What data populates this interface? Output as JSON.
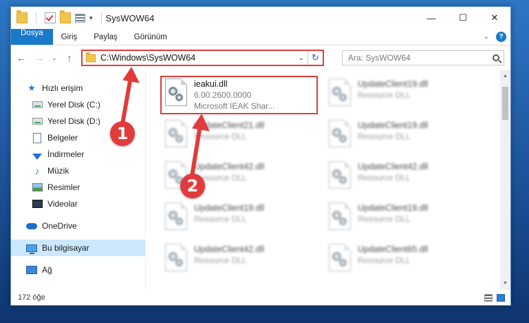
{
  "window": {
    "title": "SysWOW64",
    "controls": {
      "minimize": "—",
      "maximize": "☐",
      "close": "✕"
    }
  },
  "ribbon": {
    "tabs": [
      "Dosya",
      "Giriş",
      "Paylaş",
      "Görünüm"
    ],
    "help": "?"
  },
  "nav": {
    "address": "C:\\Windows\\SysWOW64",
    "search_placeholder": "Ara: SysWOW64"
  },
  "sidebar": {
    "quick_access": "Hızlı erişim",
    "pinned": [
      "Yerel Disk (C:)",
      "Yerel Disk (D:)",
      "Belgeler",
      "İndirmeler",
      "Müzik",
      "Resimler",
      "Videolar"
    ],
    "onedrive": "OneDrive",
    "this_pc": "Bu bilgisayar",
    "network": "Ağ"
  },
  "files": {
    "highlighted": {
      "name": "ieakui.dll",
      "version": "6.00.2600.0000",
      "description": "Microsoft IEAK Shar..."
    },
    "others": [
      {
        "name": "UpdateClient19.dll",
        "type": "Resource DLL"
      },
      {
        "name": "UpdateClient21.dll",
        "type": "Resource DLL"
      },
      {
        "name": "UpdateClient19.dll",
        "type": "Resource DLL"
      },
      {
        "name": "UpdateClient42.dll",
        "type": "Resource DLL"
      },
      {
        "name": "UpdateClient42.dll",
        "type": "Resource DLL"
      },
      {
        "name": "UpdateClient19.dll",
        "type": "Resource DLL"
      },
      {
        "name": "UpdateClient19.dll",
        "type": "Resource DLL"
      },
      {
        "name": "UpdateClient42.dll",
        "type": "Resource DLL"
      },
      {
        "name": "UpdateClient65.dll",
        "type": "Resource DLL"
      }
    ]
  },
  "status": {
    "count": "172 öğe"
  },
  "annotations": {
    "step1": "1",
    "step2": "2"
  },
  "colors": {
    "accent": "#1979ca",
    "annotation": "#e23b3b",
    "selected": "#cce8ff"
  }
}
